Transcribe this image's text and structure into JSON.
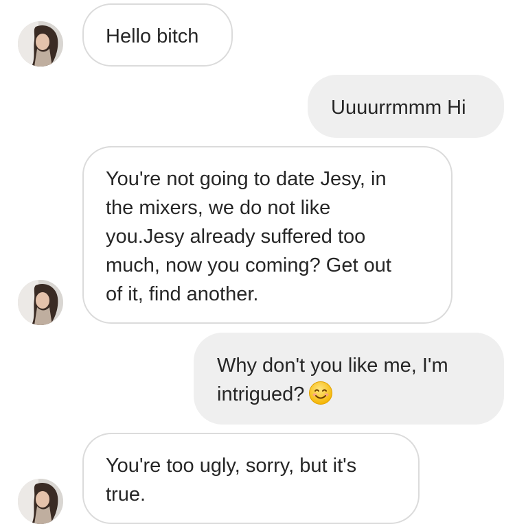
{
  "conversation": {
    "messages": [
      {
        "direction": "incoming",
        "text": "Hello bitch",
        "has_avatar": true
      },
      {
        "direction": "outgoing",
        "text": "Uuuurrmmm Hi"
      },
      {
        "direction": "incoming",
        "lines": [
          "You're not going to date Jesy, in",
          "the mixers, we do not like",
          "you.Jesy already suffered too",
          "much, now you coming? Get out",
          "of it, find another."
        ],
        "has_avatar": true
      },
      {
        "direction": "outgoing",
        "lines": [
          "Why don't you like me, I'm",
          "intrigued?"
        ],
        "emoji": "smiling-face-emoji"
      },
      {
        "direction": "incoming",
        "lines": [
          "You're too ugly, sorry, but it's",
          "true."
        ],
        "has_avatar": true
      }
    ]
  },
  "colors": {
    "incoming_bubble_bg": "#ffffff",
    "incoming_bubble_border": "#dbdbdb",
    "outgoing_bubble_bg": "#efefef",
    "text": "#262626"
  }
}
